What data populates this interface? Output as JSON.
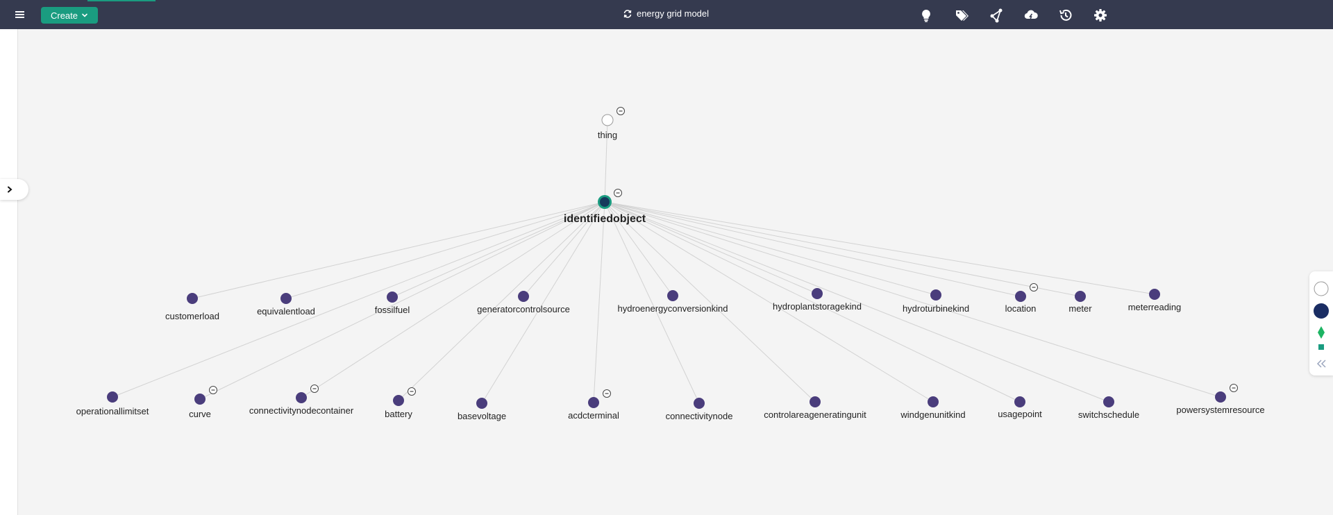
{
  "header": {
    "create_label": "Create",
    "title": "energy grid model",
    "tools": [
      "lightbulb-icon",
      "tags-icon",
      "graph-share-icon",
      "cloud-sync-icon",
      "history-icon",
      "settings-gear-icon"
    ]
  },
  "colors": {
    "topbar": "#353a4f",
    "accent": "#1a9c80",
    "node": "#4a3d7c",
    "focus_node": "#163a5c",
    "edge": "#d2d2d2"
  },
  "graph": {
    "root": {
      "label": "thing",
      "collapsible": true
    },
    "focus": {
      "label": "identifiedobject",
      "collapsible": true
    },
    "row1": [
      {
        "label": "customerload",
        "collapsible": false
      },
      {
        "label": "equivalentload",
        "collapsible": false
      },
      {
        "label": "fossilfuel",
        "collapsible": false
      },
      {
        "label": "generatorcontrolsource",
        "collapsible": false
      },
      {
        "label": "hydroenergyconversionkind",
        "collapsible": false
      },
      {
        "label": "hydroplantstoragekind",
        "collapsible": false
      },
      {
        "label": "hydroturbinekind",
        "collapsible": false
      },
      {
        "label": "location",
        "collapsible": true
      },
      {
        "label": "meter",
        "collapsible": false
      },
      {
        "label": "meterreading",
        "collapsible": false
      }
    ],
    "row2": [
      {
        "label": "operationallimitset",
        "collapsible": false
      },
      {
        "label": "curve",
        "collapsible": true
      },
      {
        "label": "connectivitynodecontainer",
        "collapsible": true
      },
      {
        "label": "battery",
        "collapsible": true
      },
      {
        "label": "basevoltage",
        "collapsible": false
      },
      {
        "label": "acdcterminal",
        "collapsible": true
      },
      {
        "label": "connectivitynode",
        "collapsible": false
      },
      {
        "label": "controlareageneratingunit",
        "collapsible": false
      },
      {
        "label": "windgenunitkind",
        "collapsible": false
      },
      {
        "label": "usagepoint",
        "collapsible": false
      },
      {
        "label": "switchschedule",
        "collapsible": false
      },
      {
        "label": "powersystemresource",
        "collapsible": true
      }
    ]
  },
  "legend": {
    "items": [
      "class-outline-circle-icon",
      "class-filled-circle-icon",
      "diamond-icon",
      "square-icon",
      "collapse-double-chevron-icon"
    ]
  }
}
